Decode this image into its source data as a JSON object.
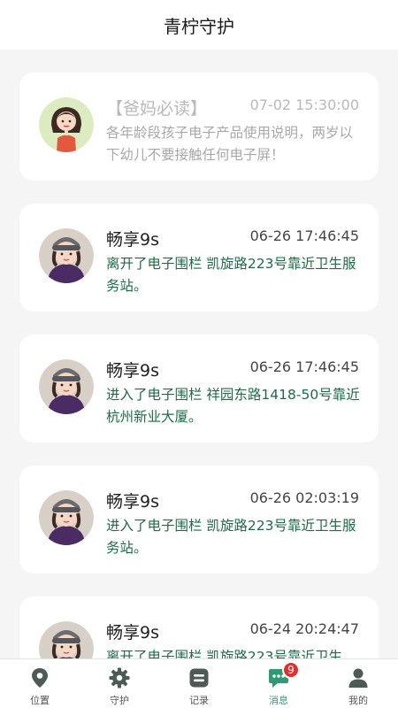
{
  "header": {
    "title": "青柠守护"
  },
  "messages": [
    {
      "name": "【爸妈必读】",
      "time": "07-02 15:30:00",
      "text": "各年龄段孩子电子产品使用说明，两岁以下幼儿不要接触任何电子屏！"
    },
    {
      "name": "畅享9s",
      "time": "06-26 17:46:45",
      "text": "离开了电子围栏 凯旋路223号靠近卫生服务站。"
    },
    {
      "name": "畅享9s",
      "time": "06-26 17:46:45",
      "text": "进入了电子围栏 祥园东路1418-50号靠近杭州新业大厦。"
    },
    {
      "name": "畅享9s",
      "time": "06-26 02:03:19",
      "text": "进入了电子围栏 凯旋路223号靠近卫生服务站。"
    },
    {
      "name": "畅享9s",
      "time": "06-24 20:24:47",
      "text": "离开了电子围栏 凯旋路223号靠近卫生"
    }
  ],
  "tabbar": {
    "items": [
      {
        "label": "位置",
        "icon": "location-pin-icon"
      },
      {
        "label": "守护",
        "icon": "gear-icon"
      },
      {
        "label": "记录",
        "icon": "record-icon"
      },
      {
        "label": "消息",
        "icon": "chat-bubble-icon",
        "badge": "9",
        "active": true
      },
      {
        "label": "我的",
        "icon": "person-icon"
      }
    ]
  },
  "colors": {
    "accent": "#2f9b74",
    "message_text": "#1e6b46",
    "badge": "#e52d2d",
    "inactive_icon": "#4e5a55"
  }
}
